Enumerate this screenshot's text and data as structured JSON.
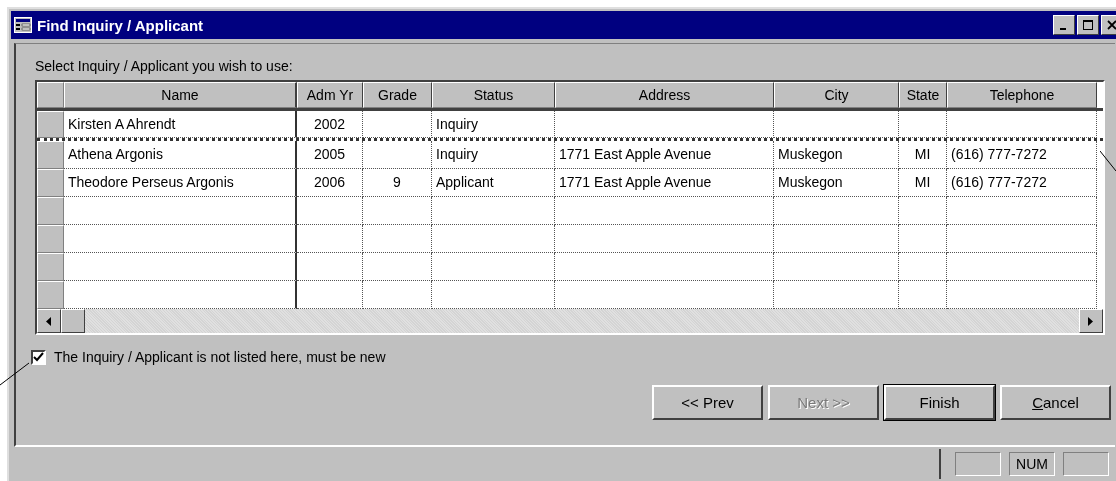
{
  "window": {
    "title": "Find Inquiry / Applicant"
  },
  "prompt": "Select Inquiry / Applicant you wish to use:",
  "table": {
    "columns": [
      "Name",
      "Adm Yr",
      "Grade",
      "Status",
      "Address",
      "City",
      "State",
      "Telephone"
    ],
    "rows": [
      {
        "current": true,
        "cells": [
          "Kirsten A Ahrendt",
          "2002",
          null,
          "Inquiry",
          null,
          null,
          null,
          null
        ]
      },
      {
        "current": false,
        "cells": [
          "Athena Argonis",
          "2005",
          null,
          "Inquiry",
          "1771 East Apple Avenue",
          "Muskegon",
          "MI",
          "(616) 777-7272"
        ]
      },
      {
        "current": false,
        "cells": [
          "Theodore Perseus Argonis",
          "2006",
          "9",
          "Applicant",
          "1771 East Apple Avenue",
          "Muskegon",
          "MI",
          "(616) 777-7272"
        ]
      },
      {
        "current": false,
        "kind": "blank"
      },
      {
        "current": false,
        "kind": "blank"
      },
      {
        "current": false,
        "kind": "blank"
      },
      {
        "current": false,
        "kind": "blank"
      }
    ]
  },
  "new_checkbox": {
    "label": "The Inquiry / Applicant is not listed here, must be new",
    "checked": true
  },
  "buttons": [
    {
      "label": "<< Prev",
      "disabled": false,
      "default": false,
      "mnemonic": false
    },
    {
      "label": "Next >>",
      "disabled": true,
      "default": false,
      "mnemonic": false
    },
    {
      "label": "Finish",
      "disabled": false,
      "default": true,
      "mnemonic": false
    },
    {
      "label": "Cancel",
      "disabled": false,
      "default": false,
      "mnemonic": true
    }
  ],
  "status_bar": {
    "panels": [
      {
        "kind": "empty"
      },
      {
        "kind": "text",
        "label": "NUM"
      },
      {
        "kind": "empty"
      }
    ]
  }
}
